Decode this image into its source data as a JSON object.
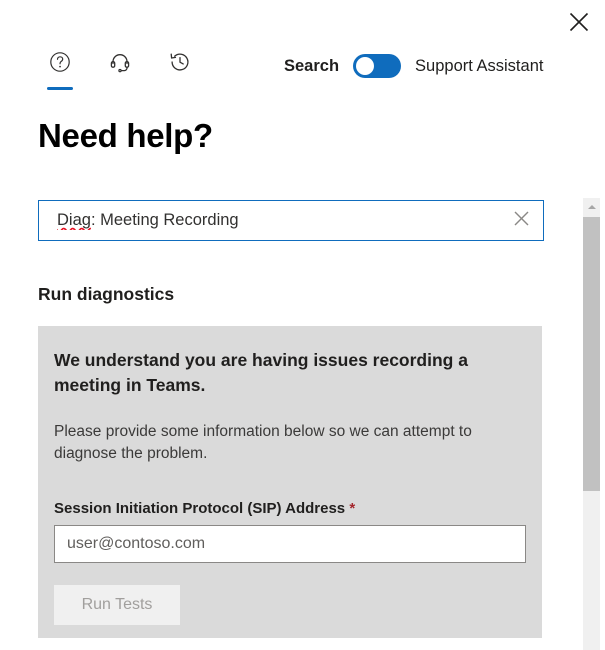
{
  "window": {
    "close_label": "Close",
    "close_icon": "close-icon"
  },
  "header": {
    "tabs": [
      {
        "id": "help",
        "icon": "question-circle-icon",
        "label": "Help",
        "active": true
      },
      {
        "id": "contact-support",
        "icon": "headset-icon",
        "label": "Contact support",
        "active": false
      },
      {
        "id": "history",
        "icon": "history-clock-icon",
        "label": "History",
        "active": false
      }
    ],
    "mode_toggle": {
      "left_label": "Search",
      "right_label": "Support Assistant",
      "state": "left",
      "accent_color": "#0f6cbd"
    }
  },
  "main": {
    "title": "Need help?",
    "search": {
      "value_misspelled": "Diag",
      "value_rest": ": Meeting Recording",
      "full_value": "Diag: Meeting Recording",
      "clear_icon": "close-icon",
      "border_color": "#0f6cbd",
      "spellcheck_underline_color": "#e81123"
    },
    "section_heading": "Run diagnostics",
    "diagnostics": {
      "panel_color": "#dadada",
      "headline": "We understand you are having issues recording a meeting in Teams.",
      "description": "Please provide some information below so we can attempt to diagnose the problem.",
      "field": {
        "label": "Session Initiation Protocol (SIP) Address",
        "required_marker": "*",
        "required_color": "#a4262c",
        "placeholder": "user@contoso.com",
        "value": ""
      },
      "submit_button": {
        "label": "Run Tests",
        "disabled": true
      }
    }
  },
  "scrollbar": {
    "up_arrow_icon": "chevron-up-icon",
    "orientation": "vertical"
  }
}
